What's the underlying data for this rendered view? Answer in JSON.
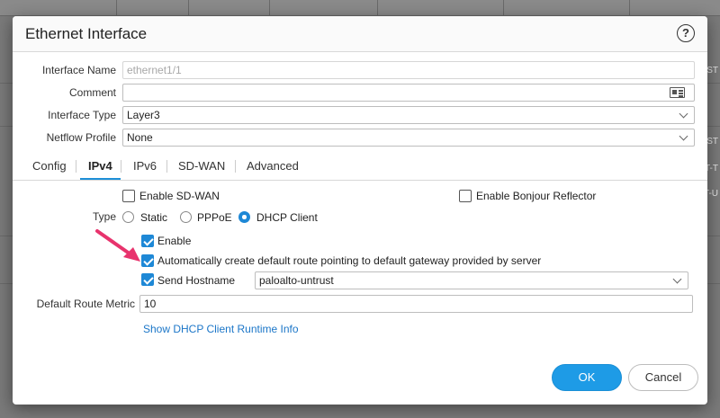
{
  "background": {
    "row_snippets": [
      "UST",
      "UST",
      "T-T",
      "T-U"
    ]
  },
  "dialog": {
    "title": "Ethernet Interface",
    "help_icon": "question-circle-icon"
  },
  "fields": {
    "interface_name": {
      "label": "Interface Name",
      "value": "ethernet1/1"
    },
    "comment": {
      "label": "Comment",
      "value": ""
    },
    "interface_type": {
      "label": "Interface Type",
      "value": "Layer3"
    },
    "netflow_profile": {
      "label": "Netflow Profile",
      "value": "None"
    }
  },
  "tabs": [
    {
      "label": "Config",
      "active": false
    },
    {
      "label": "IPv4",
      "active": true
    },
    {
      "label": "IPv6",
      "active": false
    },
    {
      "label": "SD-WAN",
      "active": false
    },
    {
      "label": "Advanced",
      "active": false
    }
  ],
  "ipv4": {
    "enable_sdwan": {
      "label": "Enable SD-WAN",
      "checked": false
    },
    "enable_bonjour": {
      "label": "Enable Bonjour Reflector",
      "checked": false
    },
    "type_label": "Type",
    "type_options": [
      {
        "label": "Static",
        "checked": false
      },
      {
        "label": "PPPoE",
        "checked": false
      },
      {
        "label": "DHCP Client",
        "checked": true
      }
    ],
    "enable": {
      "label": "Enable",
      "checked": true
    },
    "auto_default_route": {
      "label": "Automatically create default route pointing to default gateway provided by server",
      "checked": true
    },
    "send_hostname": {
      "label": "Send Hostname",
      "checked": true,
      "value": "paloalto-untrust"
    },
    "default_route_metric": {
      "label": "Default Route Metric",
      "value": "10"
    },
    "runtime_info_link": "Show DHCP Client Runtime Info"
  },
  "buttons": {
    "ok": "OK",
    "cancel": "Cancel"
  },
  "colors": {
    "accent": "#1e88d6",
    "ok_button": "#1e9be6",
    "link": "#1b76c8",
    "arrow": "#e8336d"
  }
}
